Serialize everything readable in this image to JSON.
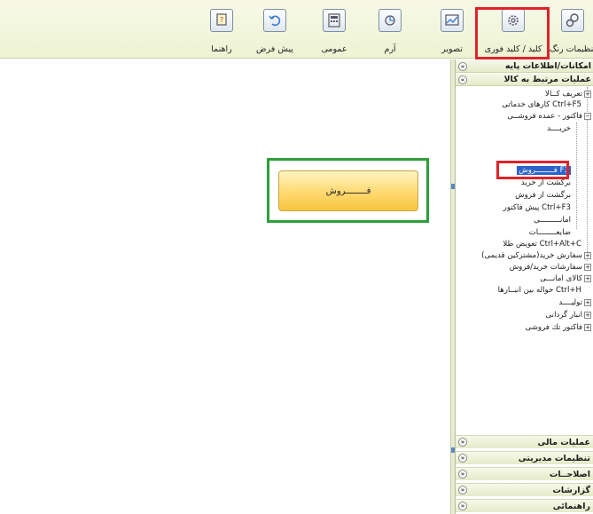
{
  "toolbar": {
    "buttons": [
      {
        "label": "تنظیمات رنگ",
        "icon": "gears-icon"
      },
      {
        "label": "کلید / کلید فوری",
        "icon": "gear-icon"
      },
      {
        "label": "تصویر",
        "icon": "image-icon"
      },
      {
        "label": "آرم",
        "icon": "logo-icon"
      },
      {
        "label": "عمومی",
        "icon": "calculator-icon"
      },
      {
        "label": "پیش فرض",
        "icon": "undo-icon"
      },
      {
        "label": "راهنما",
        "icon": "help-icon"
      }
    ]
  },
  "work": {
    "sale_button_label": "فــــــــروش"
  },
  "panel": {
    "sections": {
      "base_info": "امکانات/اطلاعات پایه",
      "goods_ops": "عملیات مرتبط به کالا"
    },
    "tree": [
      {
        "label": "تعریف کــالا",
        "pm": "+"
      },
      {
        "label": "کارهای خدماتی Ctrl+F5",
        "pm": ""
      },
      {
        "label": "فاکتور - عمده فروشــی",
        "pm": "−"
      },
      {
        "label": "خریــــد",
        "pm": ""
      },
      {
        "label": "فــــــــروش F3",
        "pm": "",
        "selected": true
      },
      {
        "label": "برگشت از خرید",
        "pm": ""
      },
      {
        "label": "برگشت از فروش",
        "pm": ""
      },
      {
        "label": "پیش فاکتور Ctrl+F3",
        "pm": ""
      },
      {
        "label": "امانـــــــــی",
        "pm": ""
      },
      {
        "label": "ضایعــــــــات",
        "pm": ""
      },
      {
        "label": "تعویض طلا Ctrl+Alt+C",
        "pm": ""
      },
      {
        "label": "سفارش خرید(مشترکین قدیمی)",
        "pm": "+"
      },
      {
        "label": "سفارشات خرید/فروش",
        "pm": "+"
      },
      {
        "label": "کالای امانـــی",
        "pm": "+"
      },
      {
        "label": "حواله بین انبــارها Ctrl+H",
        "pm": ""
      },
      {
        "label": "تولیــــد",
        "pm": "+"
      },
      {
        "label": "انبار گردانی",
        "pm": "+"
      },
      {
        "label": "فاکتور تك فروشی",
        "pm": "+"
      }
    ],
    "bottom_sections": [
      "عملیات مالی",
      "تنظیمات مدیریتی",
      "اصلاحــات",
      "گزارشات",
      "راهنمائی"
    ]
  },
  "colors": {
    "highlight_red": "#e0232b",
    "highlight_green": "#2f9e3c",
    "selection_blue": "#2b63c8"
  }
}
